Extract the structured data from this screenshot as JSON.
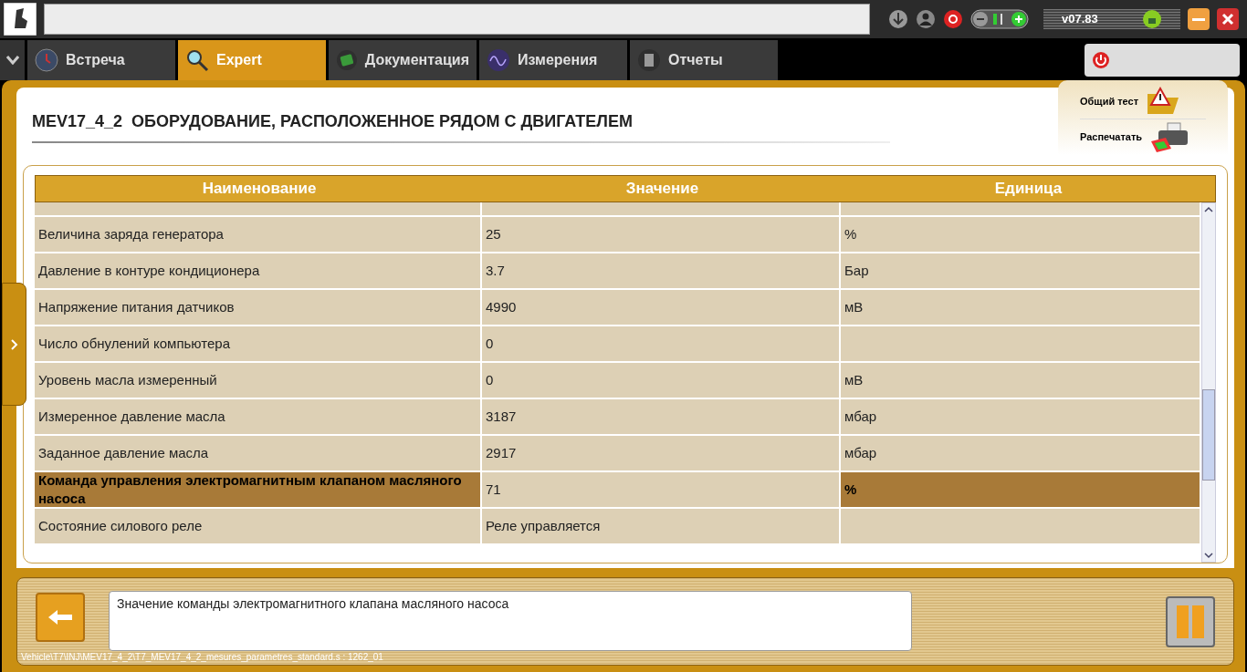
{
  "top_bar": {
    "version": "v07.83"
  },
  "tabs": [
    {
      "label": "Встреча",
      "selected": false,
      "kind": "clock"
    },
    {
      "label": "Expert",
      "selected": true,
      "kind": "magnifier"
    },
    {
      "label": "Документация",
      "selected": false,
      "kind": "book"
    },
    {
      "label": "Измерения",
      "selected": false,
      "kind": "wave"
    },
    {
      "label": "Отчеты",
      "selected": false,
      "kind": "report"
    }
  ],
  "header": {
    "title": "MEV17_4_2  ОБОРУДОВАНИЕ, РАСПОЛОЖЕННОЕ РЯДОМ С ДВИГАТЕЛЕМ"
  },
  "actions": [
    {
      "label": "Общий тест",
      "kind": "warning"
    },
    {
      "label": "Распечатать",
      "kind": "printer"
    }
  ],
  "table": {
    "columns": [
      "Наименование",
      "Значение",
      "Единица"
    ],
    "rows": [
      {
        "name": "Величина заряда генератора",
        "value": "25",
        "unit": "%",
        "selected": false
      },
      {
        "name": "Давление в контуре кондиционера",
        "value": "3.7",
        "unit": "Бар",
        "selected": false
      },
      {
        "name": "Напряжение питания датчиков",
        "value": "4990",
        "unit": "мВ",
        "selected": false
      },
      {
        "name": "Число обнулений компьютера",
        "value": "0",
        "selected": false
      },
      {
        "name": "Уровень масла измеренный",
        "value": "0",
        "unit": "мВ",
        "selected": false
      },
      {
        "name": "Измеренное давление масла",
        "value": "3187",
        "unit": "мбар",
        "selected": false
      },
      {
        "name": "Заданное давление масла",
        "value": "2917",
        "unit": "мбар",
        "selected": false
      },
      {
        "name": "Команда управления электромагнитным клапаном масляного насоса",
        "value": "71",
        "unit": "%",
        "selected": true
      },
      {
        "name": "Состояние силового реле",
        "value": "Реле управляется",
        "selected": false
      }
    ]
  },
  "description": "Значение команды электромагнитного клапана масляного насоса",
  "path": "Vehicle\\T7\\INJ\\MEV17_4_2\\T7_MEV17_4_2_mesures_parametres_standard.s : 1262_01"
}
